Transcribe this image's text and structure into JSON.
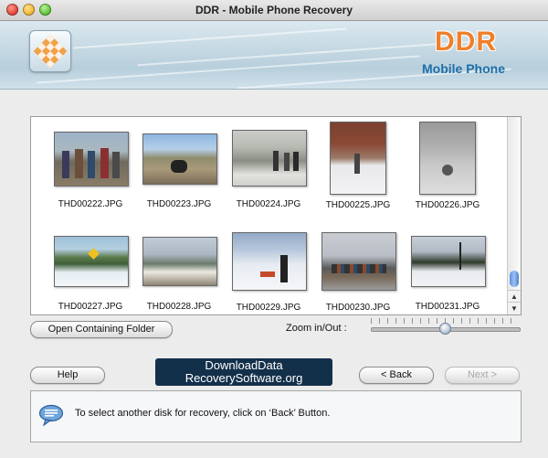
{
  "window": {
    "title": "DDR - Mobile Phone Recovery"
  },
  "banner": {
    "brand": "DDR",
    "subtitle": "Mobile Phone"
  },
  "gallery": {
    "items": [
      {
        "file": "THD00222.JPG"
      },
      {
        "file": "THD00223.JPG"
      },
      {
        "file": "THD00224.JPG"
      },
      {
        "file": "THD00225.JPG"
      },
      {
        "file": "THD00226.JPG"
      },
      {
        "file": "THD00227.JPG"
      },
      {
        "file": "THD00228.JPG"
      },
      {
        "file": "THD00229.JPG"
      },
      {
        "file": "THD00230.JPG"
      },
      {
        "file": "THD00231.JPG"
      }
    ]
  },
  "controls": {
    "open_folder": "Open Containing Folder",
    "zoom_label": "Zoom in/Out :",
    "zoom_level": 0.5
  },
  "buttons": {
    "help": "Help",
    "back": "< Back",
    "next": "Next >"
  },
  "watermark": {
    "line1": "DownloadData",
    "line2": "RecoverySoftware.org"
  },
  "info": {
    "message": "To select another disk for recovery, click on ‘Back’ Button."
  },
  "colors": {
    "brand_orange": "#f07f2a",
    "brand_blue": "#1f6ea8",
    "watermark_bg": "#13304b"
  }
}
